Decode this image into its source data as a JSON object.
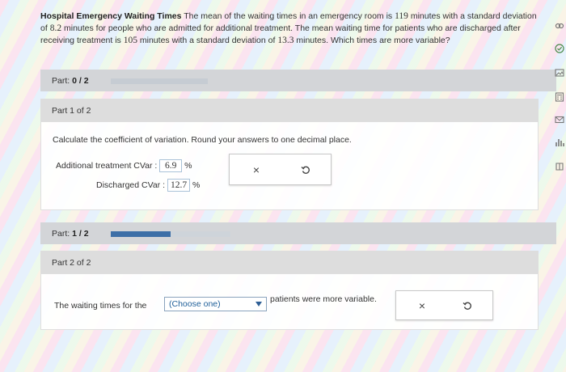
{
  "problem": {
    "title": "Hospital Emergency Waiting Times",
    "text1": "The mean of the waiting times in an emergency room is",
    "mean1": "119",
    "text2": "minutes with a standard deviation of",
    "sd1": "8.2",
    "text3": "minutes for people who are admitted for additional treatment. The mean waiting time for patients who are discharged after receiving treatment is",
    "mean2": "105",
    "text4": "minutes with a standard deviation of",
    "sd2": "13.3",
    "text5": "minutes. Which times are more variable?"
  },
  "part_bar_1": {
    "label": "Part:",
    "value": "0 / 2",
    "progress": 0
  },
  "part1": {
    "header": "Part 1 of 2",
    "instruction": "Calculate the coefficient of variation. Round your answers to one decimal place.",
    "add_label": "Additional treatment CVar :",
    "add_value": "6.9",
    "dis_label": "Discharged CVar :",
    "dis_value": "12.7",
    "unit": "%"
  },
  "part_bar_2": {
    "label": "Part:",
    "value": "1 / 2",
    "progress": 0.5
  },
  "part2": {
    "header": "Part 2 of 2",
    "sentence_start": "The waiting times for the",
    "select_value": "(Choose one)",
    "sentence_end": "patients were more variable."
  },
  "actions": {
    "clear": "×"
  },
  "rail_icons": [
    "link-icon",
    "check-icon",
    "gallery-icon",
    "calculator-icon",
    "mail-icon",
    "chart-icon",
    "book-icon"
  ]
}
